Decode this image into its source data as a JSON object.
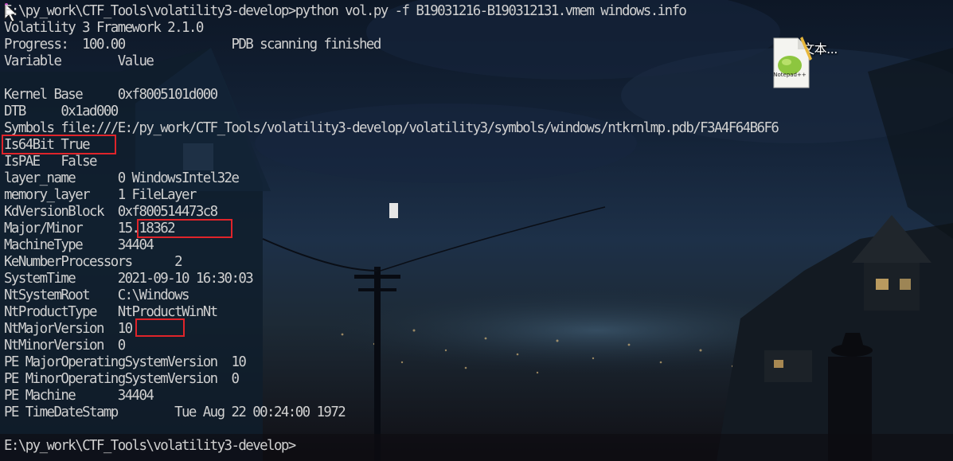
{
  "terminal": {
    "lines": [
      "E:\\py_work\\CTF_Tools\\volatility3-develop>python vol.py -f B19031216-B190312131.vmem windows.info",
      "Volatility 3 Framework 2.1.0",
      "Progress:  100.00               PDB scanning finished",
      "Variable        Value",
      "",
      "Kernel Base     0xf8005101d000",
      "DTB     0x1ad000",
      "Symbols file:///E:/py_work/CTF_Tools/volatility3-develop/volatility3/symbols/windows/ntkrnlmp.pdb/F3A4F64B6F6",
      "Is64Bit True",
      "IsPAE   False",
      "layer_name      0 WindowsIntel32e",
      "memory_layer    1 FileLayer",
      "KdVersionBlock  0xf800514473c8",
      "Major/Minor     15.18362",
      "MachineType     34404",
      "KeNumberProcessors      2",
      "SystemTime      2021-09-10 16:30:03",
      "NtSystemRoot    C:\\Windows",
      "NtProductType   NtProductWinNt",
      "NtMajorVersion  10",
      "NtMinorVersion  0",
      "PE MajorOperatingSystemVersion  10",
      "PE MinorOperatingSystemVersion  0",
      "PE Machine      34404",
      "PE TimeDateStamp        Tue Aug 22 00:24:00 1972",
      "",
      "E:\\py_work\\CTF_Tools\\volatility3-develop>"
    ]
  },
  "desktop": {
    "file_label": "新建文本...",
    "file_icon": "notepad-plus-plus-file-icon",
    "pointer_icon": "mouse-pointer-icon"
  },
  "highlight_color": "#e0242a"
}
